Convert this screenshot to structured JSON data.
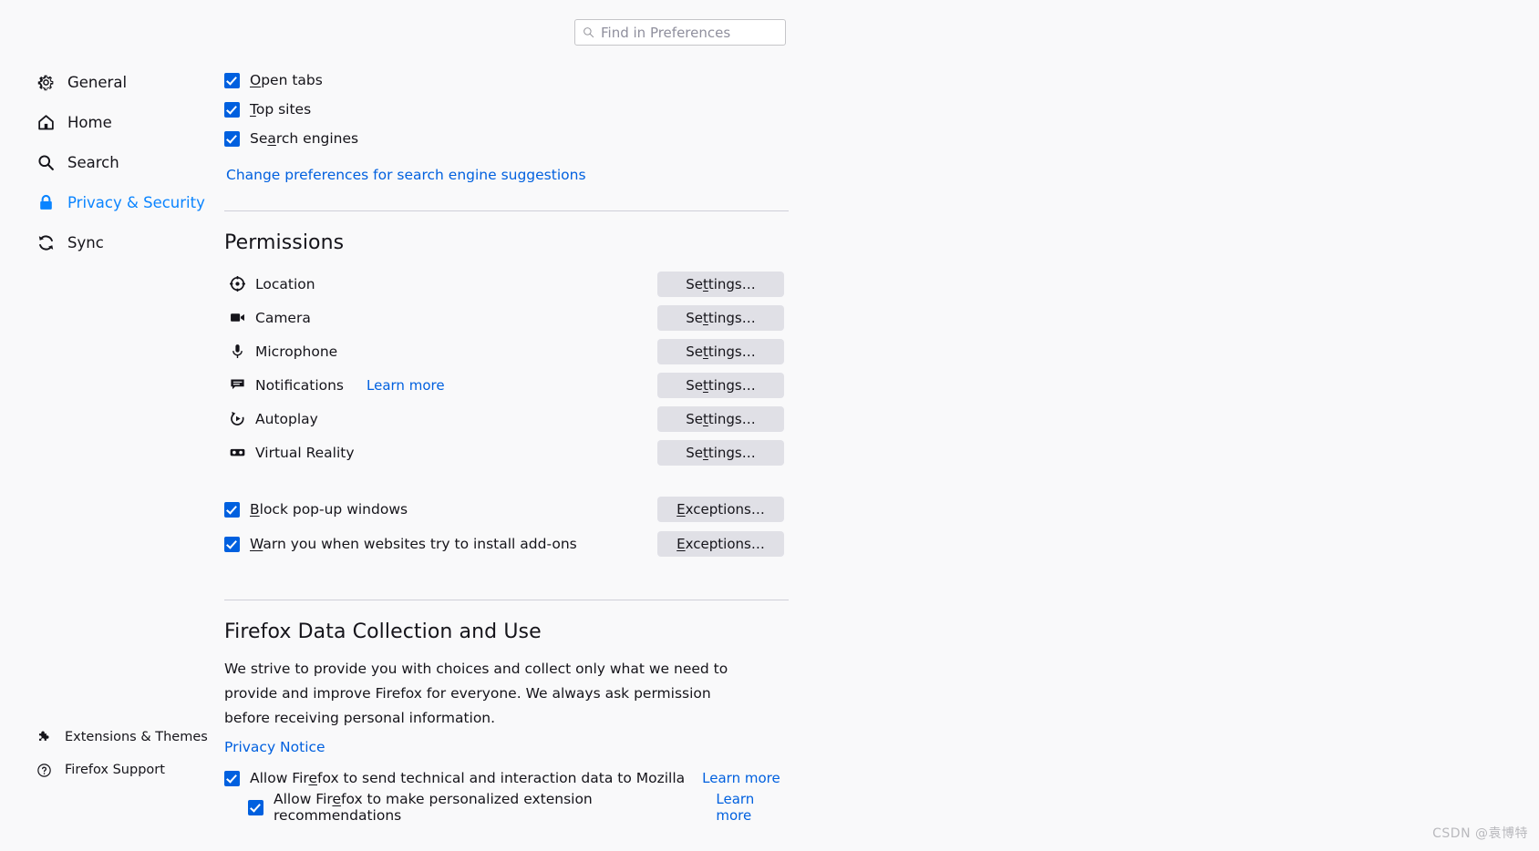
{
  "search": {
    "placeholder": "Find in Preferences",
    "value": "",
    "icon": "search-icon"
  },
  "sidebar": {
    "items": [
      {
        "label": "General",
        "icon": "gear-icon",
        "active": false
      },
      {
        "label": "Home",
        "icon": "home-icon",
        "active": false
      },
      {
        "label": "Search",
        "icon": "search-icon",
        "active": false
      },
      {
        "label": "Privacy & Security",
        "icon": "lock-icon",
        "active": true
      },
      {
        "label": "Sync",
        "icon": "sync-icon",
        "active": false
      }
    ],
    "bottom_items": [
      {
        "label": "Extensions & Themes",
        "icon": "puzzle-icon"
      },
      {
        "label": "Firefox Support",
        "icon": "question-circle-icon"
      }
    ]
  },
  "address_bar_suggestions": {
    "checkboxes": [
      {
        "label": "Open tabs",
        "accesskey": "O",
        "checked": true
      },
      {
        "label": "Top sites",
        "accesskey": "T",
        "checked": true
      },
      {
        "label": "Search engines",
        "accesskey": "a",
        "checked": true
      }
    ],
    "link": "Change preferences for search engine suggestions"
  },
  "permissions": {
    "heading": "Permissions",
    "rows": [
      {
        "label": "Location",
        "icon": "location-icon",
        "button": "Settings…",
        "button_accesskey": "t"
      },
      {
        "label": "Camera",
        "icon": "camera-icon",
        "button": "Settings…",
        "button_accesskey": "t"
      },
      {
        "label": "Microphone",
        "icon": "microphone-icon",
        "button": "Settings…",
        "button_accesskey": "t"
      },
      {
        "label": "Notifications",
        "icon": "notification-icon",
        "button": "Settings…",
        "button_accesskey": "t",
        "learn_more": "Learn more"
      },
      {
        "label": "Autoplay",
        "icon": "autoplay-icon",
        "button": "Settings…",
        "button_accesskey": "t"
      },
      {
        "label": "Virtual Reality",
        "icon": "vr-goggles-icon",
        "button": "Settings…",
        "button_accesskey": "t"
      }
    ],
    "checkbox_rows": [
      {
        "label": "Block pop-up windows",
        "accesskey": "B",
        "checked": true,
        "button": "Exceptions…",
        "button_accesskey": "E"
      },
      {
        "label": "Warn you when websites try to install add-ons",
        "accesskey": "W",
        "checked": true,
        "button": "Exceptions…",
        "button_accesskey": "E"
      }
    ]
  },
  "data_collection": {
    "heading": "Firefox Data Collection and Use",
    "paragraph": "We strive to provide you with choices and collect only what we need to provide and improve Firefox for everyone. We always ask permission before receiving personal information.",
    "privacy_notice": "Privacy Notice",
    "checkboxes": [
      {
        "label_before": "Allow Fir",
        "accesskey": "e",
        "label_after": "fox to send technical and interaction data to Mozilla",
        "checked": true,
        "learn_more": "Learn more",
        "indented": false
      },
      {
        "label_before": "Allow Fir",
        "accesskey": "e",
        "label_after": "fox to make personalized extension recommendations",
        "checked": true,
        "learn_more": "Learn more",
        "indented": true
      }
    ]
  },
  "watermark": "CSDN @袁博特",
  "colors": {
    "accent": "#0060df",
    "active_nav": "#0a84ff",
    "background": "#f9f9fa",
    "button_bg": "#e0e0e6",
    "divider": "#cfcfd8"
  }
}
